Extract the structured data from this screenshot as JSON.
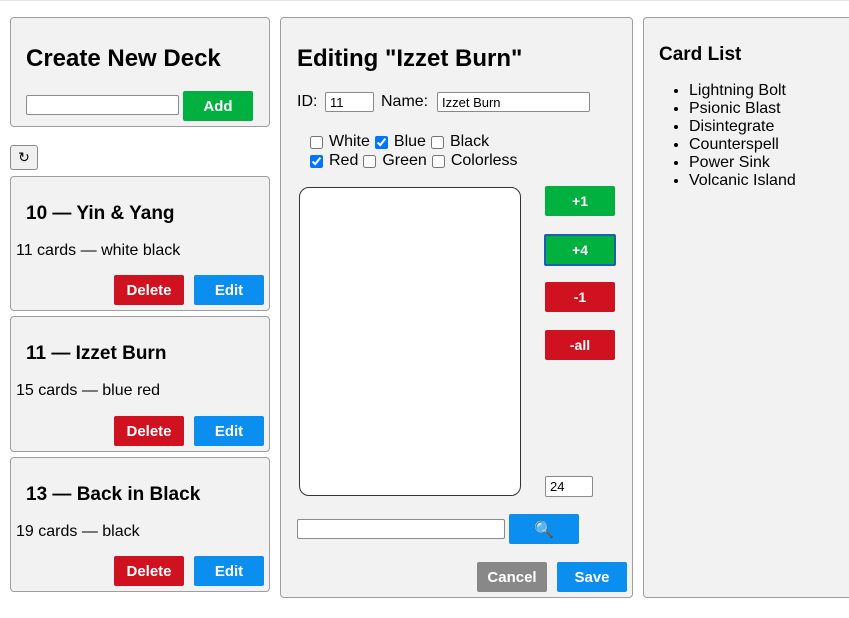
{
  "create_deck": {
    "title": "Create New Deck",
    "name_value": "",
    "add_label": "Add"
  },
  "refresh_icon": "↻",
  "decks": [
    {
      "title": "10 — Yin & Yang",
      "info": "11 cards — white black",
      "delete_label": "Delete",
      "edit_label": "Edit"
    },
    {
      "title": "11 — Izzet Burn",
      "info": "15 cards — blue red",
      "delete_label": "Delete",
      "edit_label": "Edit"
    },
    {
      "title": "13 — Back in Black",
      "info": "19 cards — black",
      "delete_label": "Delete",
      "edit_label": "Edit"
    }
  ],
  "editor": {
    "title": "Editing \"Izzet Burn\"",
    "id_label": "ID:",
    "id_value": "11",
    "name_label": "Name:",
    "name_value": "Izzet Burn",
    "colors": [
      {
        "label": "White",
        "checked": false
      },
      {
        "label": "Blue",
        "checked": true
      },
      {
        "label": "Black",
        "checked": false
      },
      {
        "label": "Red",
        "checked": true
      },
      {
        "label": "Green",
        "checked": false
      },
      {
        "label": "Colorless",
        "checked": false
      }
    ],
    "plus1_label": "+1",
    "plus4_label": "+4",
    "minus1_label": "-1",
    "minusall_label": "-all",
    "count_value": "24",
    "search_value": "",
    "search_icon": "🔍",
    "cancel_label": "Cancel",
    "save_label": "Save"
  },
  "card_list": {
    "title": "Card List",
    "items": [
      "Lightning Bolt",
      "Psionic Blast",
      "Disintegrate",
      "Counterspell",
      "Power Sink",
      "Volcanic Island"
    ]
  },
  "colors": {
    "green": "#00b140",
    "red": "#d0111f",
    "blue": "#0a8ff0",
    "gray": "#888888",
    "panel": "#f2f2f2"
  }
}
